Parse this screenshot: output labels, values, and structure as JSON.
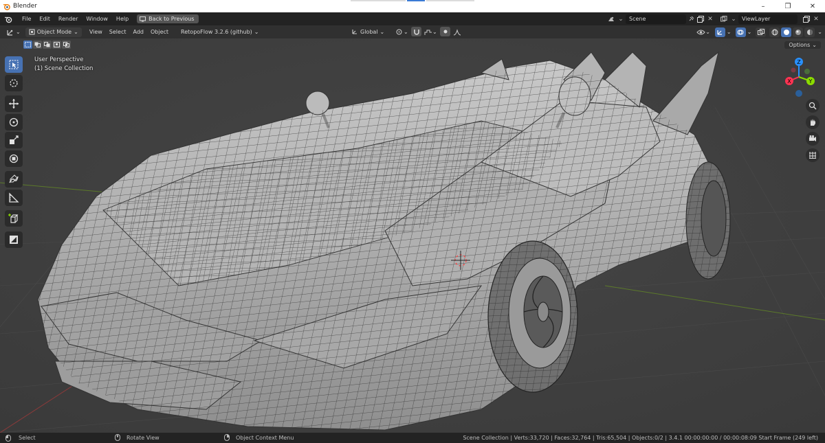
{
  "window": {
    "title": "Blender",
    "controls": [
      "–",
      "❐",
      "✕"
    ]
  },
  "topbar": {
    "menus": [
      "File",
      "Edit",
      "Render",
      "Window",
      "Help"
    ],
    "back_button": "Back to Previous",
    "scene_name": "Scene",
    "view_layer": "ViewLayer"
  },
  "header": {
    "mode": "Object Mode",
    "menus": [
      "View",
      "Select",
      "Add",
      "Object"
    ],
    "addon": "RetopoFlow 3.2.6 (github)",
    "orientation": "Global"
  },
  "viewport": {
    "perspective": "User Perspective",
    "collection": "(1) Scene Collection",
    "options_label": "Options",
    "gizmo_axes": {
      "z": "Z",
      "x": "X",
      "y": "Y"
    }
  },
  "toolbar": {
    "tools": [
      "select-box",
      "cursor",
      "move",
      "rotate",
      "scale",
      "transform",
      "annotate",
      "measure",
      "add-cube",
      "retopoflow"
    ]
  },
  "statusbar": {
    "select": "Select",
    "rotate": "Rotate View",
    "context": "Object Context Menu",
    "stats": "Scene Collection | Verts:33,720 | Faces:32,764 | Tris:65,504 | Objects:0/2 | 3.4.1   00:00:00:00 / 00:00:08:09  Start Frame (249 left)"
  },
  "colors": {
    "accent": "#4772b3",
    "axis_x": "#ff3352",
    "axis_y": "#8bdc00",
    "axis_z": "#2890ff"
  }
}
